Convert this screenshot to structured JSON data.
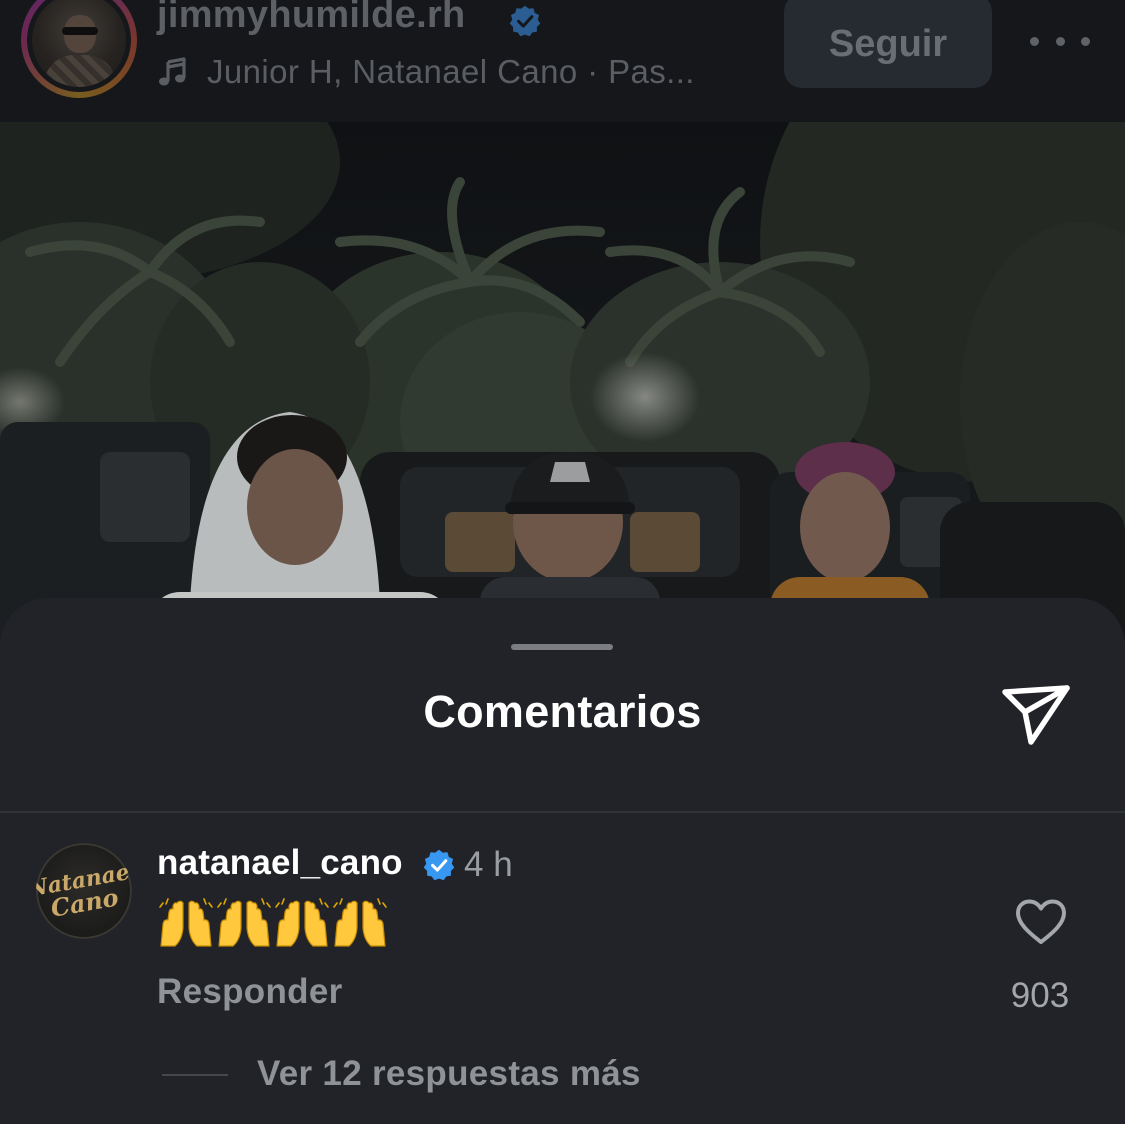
{
  "header": {
    "username": "jimmyhumilde.rh",
    "music": "Junior H, Natanael Cano · Pas...",
    "follow_label": "Seguir"
  },
  "sheet": {
    "title": "Comentarios"
  },
  "comment": {
    "username": "natanael_cano",
    "time": "4 h",
    "text": "🙌🙌🙌🙌",
    "reply_label": "Responder",
    "like_count": "903",
    "view_replies_label": "Ver 12 respuestas más",
    "avatar_text": "Natanael Cano"
  },
  "colors": {
    "verified": "#3897f0",
    "sheet_bg": "#212328",
    "header_bg": "#15171b"
  },
  "icons": {
    "header": [
      "verified-badge-icon",
      "music-note-icon",
      "more-options-icon"
    ],
    "sheet": [
      "share-icon",
      "heart-icon",
      "raising-hands-icon"
    ]
  }
}
